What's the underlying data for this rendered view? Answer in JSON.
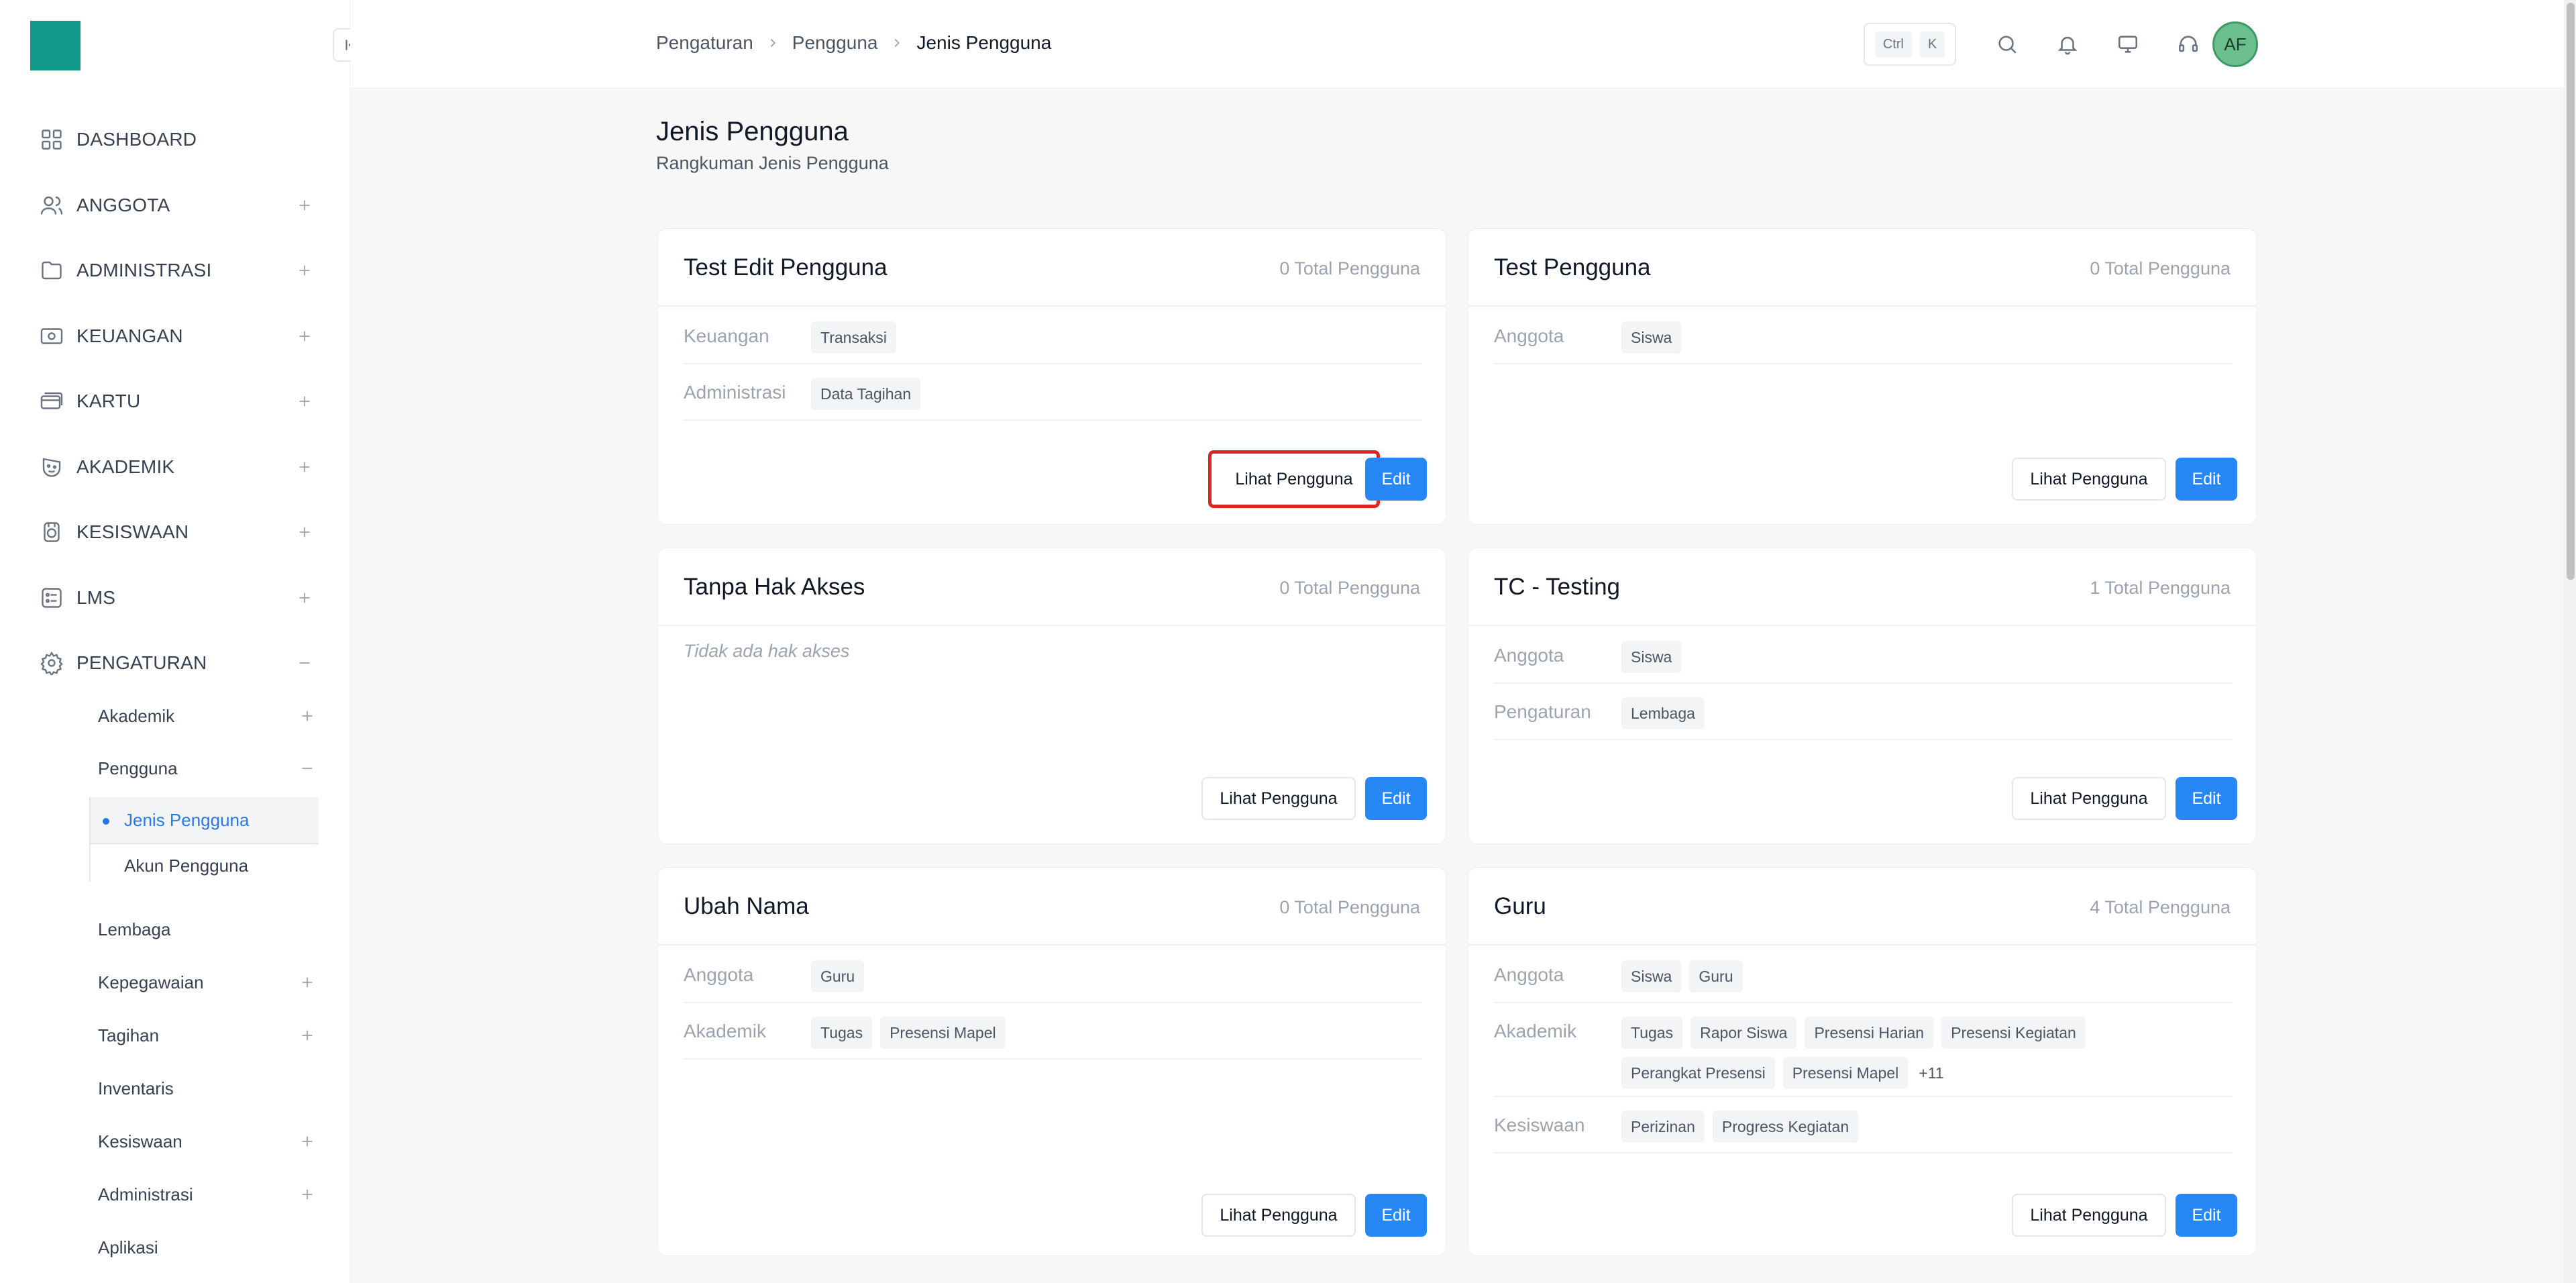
{
  "sidebar": {
    "collapse_icon": "collapse-left-icon",
    "nav": [
      {
        "label": "DASHBOARD",
        "icon": "dashboard-grid-icon"
      },
      {
        "label": "ANGGOTA",
        "icon": "users-icon"
      },
      {
        "label": "ADMINISTRASI",
        "icon": "folder-icon"
      },
      {
        "label": "KEUANGAN",
        "icon": "money-icon"
      },
      {
        "label": "KARTU",
        "icon": "cards-icon"
      },
      {
        "label": "AKADEMIK",
        "icon": "mask-icon"
      },
      {
        "label": "KESISWAAN",
        "icon": "medal-icon"
      },
      {
        "label": "LMS",
        "icon": "checklist-icon"
      },
      {
        "label": "PENGATURAN",
        "icon": "gear-icon"
      }
    ],
    "sub": {
      "akademik": "Akademik",
      "pengguna": "Pengguna",
      "jenis_pengguna": "Jenis Pengguna",
      "akun_pengguna": "Akun Pengguna",
      "lembaga": "Lembaga",
      "kepegawaian": "Kepegawaian",
      "tagihan": "Tagihan",
      "inventaris": "Inventaris",
      "kesiswaan": "Kesiswaan",
      "administrasi": "Administrasi",
      "aplikasi": "Aplikasi"
    }
  },
  "topbar": {
    "breadcrumb": [
      "Pengaturan",
      "Pengguna",
      "Jenis Pengguna"
    ],
    "kbd": [
      "Ctrl",
      "K"
    ],
    "avatar_initials": "AF"
  },
  "page": {
    "title": "Jenis Pengguna",
    "subtitle": "Rangkuman Jenis Pengguna"
  },
  "buttons": {
    "view": "Lihat Pengguna",
    "edit": "Edit"
  },
  "cards": [
    {
      "title": "Test Edit Pengguna",
      "count": "0 Total Pengguna",
      "rows": [
        {
          "label": "Keuangan",
          "tags": [
            "Transaksi"
          ]
        },
        {
          "label": "Administrasi",
          "tags": [
            "Data Tagihan"
          ]
        }
      ]
    },
    {
      "title": "Test Pengguna",
      "count": "0 Total Pengguna",
      "rows": [
        {
          "label": "Anggota",
          "tags": [
            "Siswa"
          ]
        }
      ]
    },
    {
      "title": "Tanpa Hak Akses",
      "count": "0 Total Pengguna",
      "empty": "Tidak ada hak akses"
    },
    {
      "title": "TC - Testing",
      "count": "1 Total Pengguna",
      "rows": [
        {
          "label": "Anggota",
          "tags": [
            "Siswa"
          ]
        },
        {
          "label": "Pengaturan",
          "tags": [
            "Lembaga"
          ]
        }
      ]
    },
    {
      "title": "Ubah Nama",
      "count": "0 Total Pengguna",
      "rows": [
        {
          "label": "Anggota",
          "tags": [
            "Guru"
          ]
        },
        {
          "label": "Akademik",
          "tags": [
            "Tugas",
            "Presensi Mapel"
          ]
        }
      ]
    },
    {
      "title": "Guru",
      "count": "4 Total Pengguna",
      "rows": [
        {
          "label": "Anggota",
          "tags": [
            "Siswa",
            "Guru"
          ]
        },
        {
          "label": "Akademik",
          "tags": [
            "Tugas",
            "Rapor Siswa",
            "Presensi Harian",
            "Presensi Kegiatan",
            "Perangkat Presensi",
            "Presensi Mapel"
          ],
          "more": "+11"
        },
        {
          "label": "Kesiswaan",
          "tags": [
            "Perizinan",
            "Progress Kegiatan"
          ]
        }
      ]
    }
  ]
}
